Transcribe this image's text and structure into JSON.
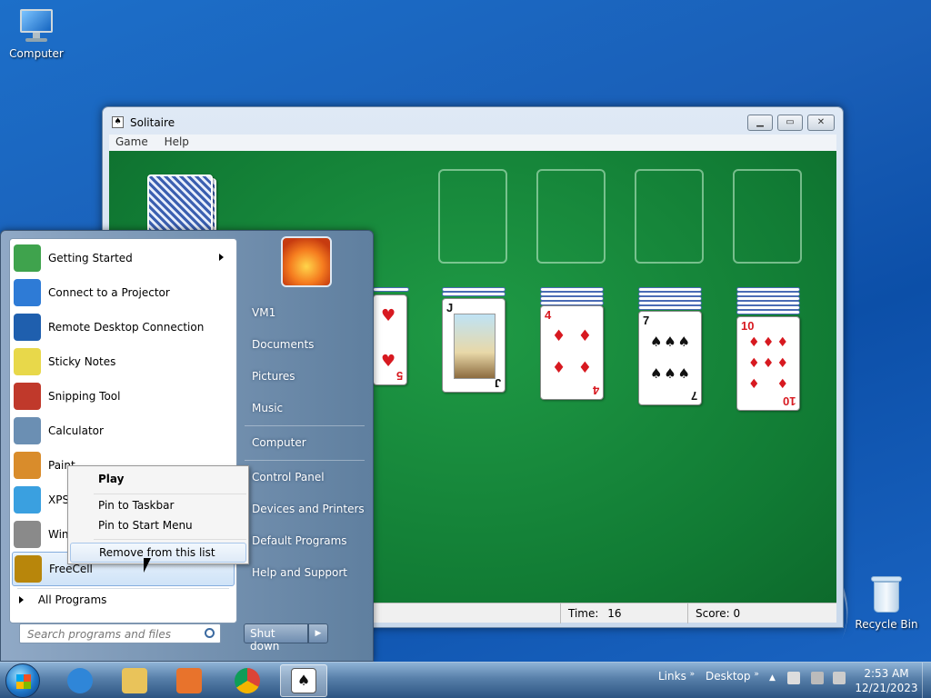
{
  "desktop": {
    "icons": [
      {
        "label": "Computer",
        "icon": "computer-icon"
      },
      {
        "label": "Recycle Bin",
        "icon": "recycle-bin-icon"
      }
    ]
  },
  "window": {
    "title": "Solitaire",
    "menu": [
      "Game",
      "Help"
    ],
    "status": {
      "time_label": "Time:",
      "time_value": "16",
      "score_label": "Score:",
      "score_value": "0"
    },
    "tableau_visible": [
      {
        "rank": "5",
        "suit": "♥",
        "color": "#d71920"
      },
      {
        "rank": "J",
        "suit": "♣",
        "color": "#111111"
      },
      {
        "rank": "4",
        "suit": "♦",
        "color": "#d71920"
      },
      {
        "rank": "7",
        "suit": "♠",
        "color": "#111111"
      },
      {
        "rank": "10",
        "suit": "♦",
        "color": "#d71920"
      }
    ]
  },
  "start_menu": {
    "programs": [
      {
        "label": "Getting Started",
        "icon": "getting-started-icon",
        "color": "#3fa34d"
      },
      {
        "label": "Connect to a Projector",
        "icon": "projector-icon",
        "color": "#2e7bd6"
      },
      {
        "label": "Remote Desktop Connection",
        "icon": "remote-desktop-icon",
        "color": "#1f5fae"
      },
      {
        "label": "Sticky Notes",
        "icon": "sticky-notes-icon",
        "color": "#e8d84a"
      },
      {
        "label": "Snipping Tool",
        "icon": "snipping-tool-icon",
        "color": "#c0392b"
      },
      {
        "label": "Calculator",
        "icon": "calculator-icon",
        "color": "#6b8fb3"
      },
      {
        "label": "Paint",
        "icon": "paint-icon",
        "color": "#d98c2b"
      },
      {
        "label": "XPS",
        "icon": "xps-viewer-icon",
        "color": "#3aa0e0"
      },
      {
        "label": "Win",
        "icon": "fax-scan-icon",
        "color": "#8a8a8a"
      },
      {
        "label": "FreeCell",
        "icon": "freecell-icon",
        "color": "#b8860b"
      }
    ],
    "all_programs": "All Programs",
    "search_placeholder": "Search programs and files",
    "user_pic": "user-picture-icon",
    "places_top": [
      "VM1",
      "Documents",
      "Pictures",
      "Music"
    ],
    "places_mid": [
      "Computer"
    ],
    "places_bottom": [
      "Control Panel",
      "Devices and Printers",
      "Default Programs",
      "Help and Support"
    ],
    "shutdown": "Shut down"
  },
  "context_menu": {
    "items": [
      "Play",
      "Pin to Taskbar",
      "Pin to Start Menu",
      "Remove from this list"
    ]
  },
  "taskbar": {
    "pinned": [
      {
        "name": "internet-explorer-icon",
        "color": "#2f86d8"
      },
      {
        "name": "file-explorer-icon",
        "color": "#e9c35a"
      },
      {
        "name": "media-player-icon",
        "color": "#e8732c"
      },
      {
        "name": "chrome-icon",
        "color": "#3c9b46"
      },
      {
        "name": "solitaire-icon",
        "color": "#ffffff"
      }
    ],
    "toolbars": [
      "Links",
      "Desktop"
    ],
    "clock_time": "2:53 AM",
    "clock_date": "12/21/2023"
  }
}
